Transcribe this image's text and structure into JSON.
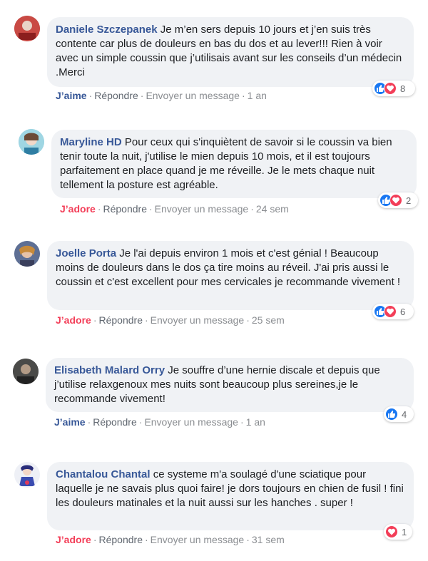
{
  "actions": {
    "reply": "Répondre",
    "message": "Envoyer un message",
    "sep": "·"
  },
  "comments": [
    {
      "author": "Daniele Szczepanek",
      "text": "Je m’en sers depuis 10 jours et j’en suis très contente car plus de douleurs en bas du dos et au lever!!! Rien à voir avec un simple coussin que j’utilisais avant sur les conseils d’un médecin .Merci",
      "reaction_label": "J’aime",
      "time": "1 an",
      "reaction_count": "8",
      "reaction_icons": [
        "like-icon",
        "love-icon"
      ]
    },
    {
      "author": "Maryline HD",
      "text": "Pour ceux qui s'inquiètent de savoir si le coussin va bien tenir toute la nuit, j'utilise le mien depuis 10 mois, et il est toujours parfaitement en place quand je me réveille. Je le mets chaque nuit tellement la posture est agréable.",
      "reaction_label": "J’adore",
      "time": "24 sem",
      "reaction_count": "2",
      "reaction_icons": [
        "like-icon",
        "love-icon"
      ]
    },
    {
      "author": "Joelle Porta",
      "text": "Je l'ai depuis environ 1 mois et c'est génial ! Beaucoup moins de douleurs dans le dos ça tire moins au réveil. J'ai pris aussi le coussin et c'est excellent pour mes cervicales je recommande vivement !",
      "reaction_label": "J’adore",
      "time": "25 sem",
      "reaction_count": "6",
      "reaction_icons": [
        "like-icon",
        "love-icon"
      ]
    },
    {
      "author": "Elisabeth Malard Orry",
      "text": "Je souffre d’une hernie discale et depuis que j’utilise relaxgenoux mes nuits sont beaucoup plus sereines,je le recommande vivement!",
      "reaction_label": "J’aime",
      "time": "1 an",
      "reaction_count": "4",
      "reaction_icons": [
        "like-icon"
      ]
    },
    {
      "author": "Chantalou Chantal",
      "text": "ce systeme m'a soulagé d'une sciatique pour laquelle je ne savais plus quoi faire! je dors toujours en chien de fusil ! fini les douleurs matinales et la nuit aussi sur les hanches . super !",
      "reaction_label": "J’adore",
      "time": "31 sem",
      "reaction_count": "1",
      "reaction_icons": [
        "love-icon"
      ]
    }
  ],
  "colors": {
    "author": "#385898",
    "like": "#1877f2",
    "love": "#f33e58",
    "bubble": "#f0f2f5"
  }
}
